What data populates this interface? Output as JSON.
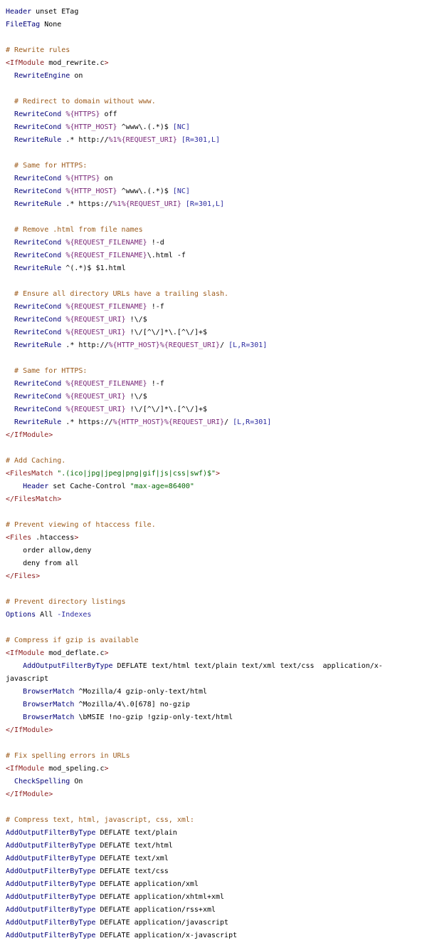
{
  "document": {
    "lines": [
      [
        [
          "d",
          "Header"
        ],
        [
          "p",
          " unset ETag"
        ]
      ],
      [
        [
          "d",
          "FileETag"
        ],
        [
          "p",
          " None"
        ]
      ],
      [],
      [
        [
          "c",
          "# Rewrite rules"
        ]
      ],
      [
        [
          "t",
          "<IfModule"
        ],
        [
          "p",
          " mod_rewrite.c"
        ],
        [
          "t",
          ">"
        ]
      ],
      [
        [
          "p",
          "  "
        ],
        [
          "d",
          "RewriteEngine"
        ],
        [
          "p",
          " on"
        ]
      ],
      [],
      [
        [
          "p",
          "  "
        ],
        [
          "c",
          "# Redirect to domain without www."
        ]
      ],
      [
        [
          "p",
          "  "
        ],
        [
          "d",
          "RewriteCond"
        ],
        [
          "p",
          " "
        ],
        [
          "v",
          "%{HTTPS}"
        ],
        [
          "p",
          " off"
        ]
      ],
      [
        [
          "p",
          "  "
        ],
        [
          "d",
          "RewriteCond"
        ],
        [
          "p",
          " "
        ],
        [
          "v",
          "%{HTTP_HOST}"
        ],
        [
          "p",
          " ^www\\.(.*)$ "
        ],
        [
          "f",
          "[NC]"
        ]
      ],
      [
        [
          "p",
          "  "
        ],
        [
          "d",
          "RewriteRule"
        ],
        [
          "p",
          " .* http://"
        ],
        [
          "v",
          "%1%{REQUEST_URI}"
        ],
        [
          "p",
          " "
        ],
        [
          "f",
          "[R=301,L]"
        ]
      ],
      [],
      [
        [
          "p",
          "  "
        ],
        [
          "c",
          "# Same for HTTPS:"
        ]
      ],
      [
        [
          "p",
          "  "
        ],
        [
          "d",
          "RewriteCond"
        ],
        [
          "p",
          " "
        ],
        [
          "v",
          "%{HTTPS}"
        ],
        [
          "p",
          " on"
        ]
      ],
      [
        [
          "p",
          "  "
        ],
        [
          "d",
          "RewriteCond"
        ],
        [
          "p",
          " "
        ],
        [
          "v",
          "%{HTTP_HOST}"
        ],
        [
          "p",
          " ^www\\.(.*)$ "
        ],
        [
          "f",
          "[NC]"
        ]
      ],
      [
        [
          "p",
          "  "
        ],
        [
          "d",
          "RewriteRule"
        ],
        [
          "p",
          " .* https://"
        ],
        [
          "v",
          "%1%{REQUEST_URI}"
        ],
        [
          "p",
          " "
        ],
        [
          "f",
          "[R=301,L]"
        ]
      ],
      [],
      [
        [
          "p",
          "  "
        ],
        [
          "c",
          "# Remove .html from file names"
        ]
      ],
      [
        [
          "p",
          "  "
        ],
        [
          "d",
          "RewriteCond"
        ],
        [
          "p",
          " "
        ],
        [
          "v",
          "%{REQUEST_FILENAME}"
        ],
        [
          "p",
          " !-d"
        ]
      ],
      [
        [
          "p",
          "  "
        ],
        [
          "d",
          "RewriteCond"
        ],
        [
          "p",
          " "
        ],
        [
          "v",
          "%{REQUEST_FILENAME}"
        ],
        [
          "p",
          "\\.html -f"
        ]
      ],
      [
        [
          "p",
          "  "
        ],
        [
          "d",
          "RewriteRule"
        ],
        [
          "p",
          " ^(.*)$ $1.html"
        ]
      ],
      [],
      [
        [
          "p",
          "  "
        ],
        [
          "c",
          "# Ensure all directory URLs have a trailing slash."
        ]
      ],
      [
        [
          "p",
          "  "
        ],
        [
          "d",
          "RewriteCond"
        ],
        [
          "p",
          " "
        ],
        [
          "v",
          "%{REQUEST_FILENAME}"
        ],
        [
          "p",
          " !-f"
        ]
      ],
      [
        [
          "p",
          "  "
        ],
        [
          "d",
          "RewriteCond"
        ],
        [
          "p",
          " "
        ],
        [
          "v",
          "%{REQUEST_URI}"
        ],
        [
          "p",
          " !\\/$"
        ]
      ],
      [
        [
          "p",
          "  "
        ],
        [
          "d",
          "RewriteCond"
        ],
        [
          "p",
          " "
        ],
        [
          "v",
          "%{REQUEST_URI}"
        ],
        [
          "p",
          " !\\/[^\\/]*\\.[^\\/]+$"
        ]
      ],
      [
        [
          "p",
          "  "
        ],
        [
          "d",
          "RewriteRule"
        ],
        [
          "p",
          " .* http://"
        ],
        [
          "v",
          "%{HTTP_HOST}%{REQUEST_URI}"
        ],
        [
          "p",
          "/ "
        ],
        [
          "f",
          "[L,R=301]"
        ]
      ],
      [],
      [
        [
          "p",
          "  "
        ],
        [
          "c",
          "# Same for HTTPS:"
        ]
      ],
      [
        [
          "p",
          "  "
        ],
        [
          "d",
          "RewriteCond"
        ],
        [
          "p",
          " "
        ],
        [
          "v",
          "%{REQUEST_FILENAME}"
        ],
        [
          "p",
          " !-f"
        ]
      ],
      [
        [
          "p",
          "  "
        ],
        [
          "d",
          "RewriteCond"
        ],
        [
          "p",
          " "
        ],
        [
          "v",
          "%{REQUEST_URI}"
        ],
        [
          "p",
          " !\\/$"
        ]
      ],
      [
        [
          "p",
          "  "
        ],
        [
          "d",
          "RewriteCond"
        ],
        [
          "p",
          " "
        ],
        [
          "v",
          "%{REQUEST_URI}"
        ],
        [
          "p",
          " !\\/[^\\/]*\\.[^\\/]+$"
        ]
      ],
      [
        [
          "p",
          "  "
        ],
        [
          "d",
          "RewriteRule"
        ],
        [
          "p",
          " .* https://"
        ],
        [
          "v",
          "%{HTTP_HOST}%{REQUEST_URI}"
        ],
        [
          "p",
          "/ "
        ],
        [
          "f",
          "[L,R=301]"
        ]
      ],
      [
        [
          "t",
          "</IfModule>"
        ]
      ],
      [],
      [
        [
          "c",
          "# Add Caching."
        ]
      ],
      [
        [
          "t",
          "<FilesMatch"
        ],
        [
          "p",
          " "
        ],
        [
          "s",
          "\".(ico|jpg|jpeg|png|gif|js|css|swf)$\""
        ],
        [
          "t",
          ">"
        ]
      ],
      [
        [
          "p",
          "    "
        ],
        [
          "d",
          "Header"
        ],
        [
          "p",
          " set Cache-Control "
        ],
        [
          "s",
          "\"max-age=86400\""
        ]
      ],
      [
        [
          "t",
          "</FilesMatch>"
        ]
      ],
      [],
      [
        [
          "c",
          "# Prevent viewing of htaccess file."
        ]
      ],
      [
        [
          "t",
          "<Files"
        ],
        [
          "p",
          " .htaccess"
        ],
        [
          "t",
          ">"
        ]
      ],
      [
        [
          "p",
          "    order allow,deny"
        ]
      ],
      [
        [
          "p",
          "    deny from all"
        ]
      ],
      [
        [
          "t",
          "</Files>"
        ]
      ],
      [],
      [
        [
          "c",
          "# Prevent directory listings"
        ]
      ],
      [
        [
          "d",
          "Options"
        ],
        [
          "p",
          " All "
        ],
        [
          "f",
          "-Indexes"
        ]
      ],
      [],
      [
        [
          "c",
          "# Compress if gzip is available"
        ]
      ],
      [
        [
          "t",
          "<IfModule"
        ],
        [
          "p",
          " mod_deflate.c"
        ],
        [
          "t",
          ">"
        ]
      ],
      [
        [
          "p",
          "    "
        ],
        [
          "d",
          "AddOutputFilterByType"
        ],
        [
          "p",
          " DEFLATE text/html text/plain text/xml text/css  application/x-"
        ]
      ],
      [
        [
          "p",
          "javascript"
        ]
      ],
      [
        [
          "p",
          "    "
        ],
        [
          "d",
          "BrowserMatch"
        ],
        [
          "p",
          " ^Mozilla/4 gzip-only-text/html"
        ]
      ],
      [
        [
          "p",
          "    "
        ],
        [
          "d",
          "BrowserMatch"
        ],
        [
          "p",
          " ^Mozilla/4\\.0[678] no-gzip"
        ]
      ],
      [
        [
          "p",
          "    "
        ],
        [
          "d",
          "BrowserMatch"
        ],
        [
          "p",
          " \\bMSIE !no-gzip !gzip-only-text/html"
        ]
      ],
      [
        [
          "t",
          "</IfModule>"
        ]
      ],
      [],
      [
        [
          "c",
          "# Fix spelling errors in URLs"
        ]
      ],
      [
        [
          "t",
          "<IfModule"
        ],
        [
          "p",
          " mod_speling.c"
        ],
        [
          "t",
          ">"
        ]
      ],
      [
        [
          "p",
          "  "
        ],
        [
          "d",
          "CheckSpelling"
        ],
        [
          "p",
          " On"
        ]
      ],
      [
        [
          "t",
          "</IfModule>"
        ]
      ],
      [],
      [
        [
          "c",
          "# Compress text, html, javascript, css, xml:"
        ]
      ],
      [
        [
          "d",
          "AddOutputFilterByType"
        ],
        [
          "p",
          " DEFLATE text/plain"
        ]
      ],
      [
        [
          "d",
          "AddOutputFilterByType"
        ],
        [
          "p",
          " DEFLATE text/html"
        ]
      ],
      [
        [
          "d",
          "AddOutputFilterByType"
        ],
        [
          "p",
          " DEFLATE text/xml"
        ]
      ],
      [
        [
          "d",
          "AddOutputFilterByType"
        ],
        [
          "p",
          " DEFLATE text/css"
        ]
      ],
      [
        [
          "d",
          "AddOutputFilterByType"
        ],
        [
          "p",
          " DEFLATE application/xml"
        ]
      ],
      [
        [
          "d",
          "AddOutputFilterByType"
        ],
        [
          "p",
          " DEFLATE application/xhtml+xml"
        ]
      ],
      [
        [
          "d",
          "AddOutputFilterByType"
        ],
        [
          "p",
          " DEFLATE application/rss+xml"
        ]
      ],
      [
        [
          "d",
          "AddOutputFilterByType"
        ],
        [
          "p",
          " DEFLATE application/javascript"
        ]
      ],
      [
        [
          "d",
          "AddOutputFilterByType"
        ],
        [
          "p",
          " DEFLATE application/x-javascript"
        ]
      ]
    ]
  },
  "colors": {
    "directive": "#00007a",
    "tag": "#8b1a1a",
    "comment": "#9c5a1a",
    "variable": "#7a2a7a",
    "flag": "#2a2aa0",
    "string": "#006400",
    "plain": "#000000",
    "background": "#ffffff"
  }
}
